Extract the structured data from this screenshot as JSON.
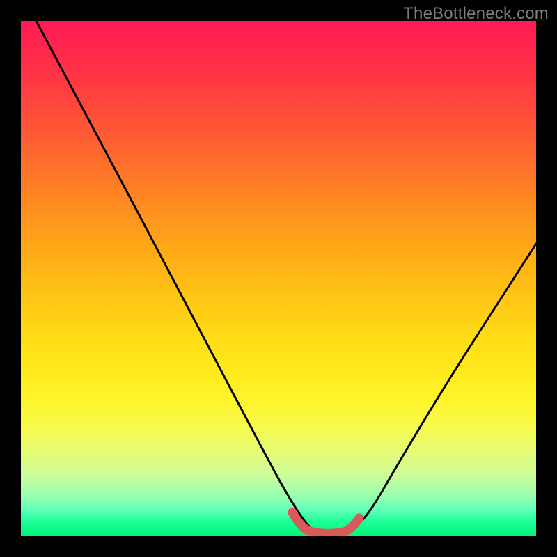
{
  "watermark": "TheBottleneck.com",
  "colors": {
    "curve": "#000000",
    "marker": "#d85a5a",
    "gradient_top": "#ff1a55",
    "gradient_bottom": "#00f57a",
    "frame": "#000000"
  },
  "chart_data": {
    "type": "line",
    "title": "",
    "xlabel": "",
    "ylabel": "",
    "xlim": [
      0,
      100
    ],
    "ylim": [
      0,
      100
    ],
    "series": [
      {
        "name": "bottleneck-curve",
        "x": [
          3,
          6,
          10,
          14,
          18,
          22,
          26,
          30,
          34,
          38,
          42,
          45,
          48,
          51,
          53,
          55,
          57,
          60,
          62,
          65,
          68,
          72,
          76,
          80,
          84,
          88,
          92,
          96,
          100
        ],
        "y": [
          100,
          94,
          87,
          80,
          73,
          66,
          59,
          52,
          45,
          38,
          31,
          24,
          17,
          10,
          5,
          2,
          1,
          1,
          2,
          5,
          10,
          16,
          22,
          28,
          34,
          40,
          46,
          52,
          58
        ]
      },
      {
        "name": "minimum-band",
        "x": [
          51,
          53,
          55,
          57,
          59,
          61,
          63
        ],
        "y": [
          4,
          2,
          1,
          1,
          1,
          2,
          4
        ]
      }
    ],
    "annotations": []
  }
}
